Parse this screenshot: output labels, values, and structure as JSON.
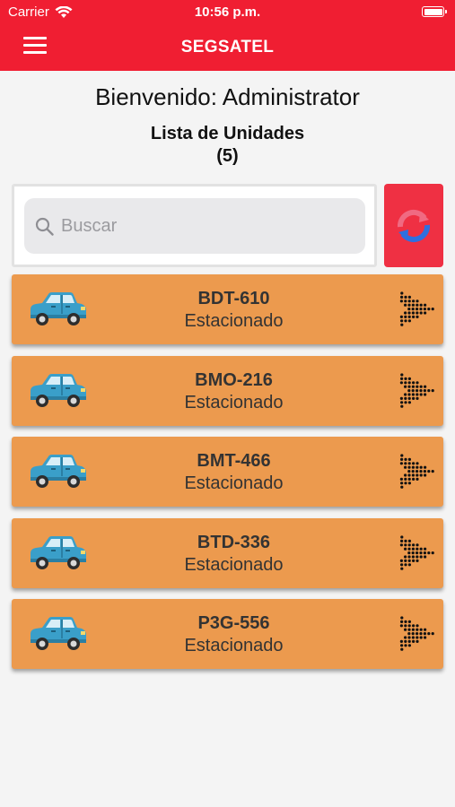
{
  "status_bar": {
    "carrier": "Carrier",
    "time": "10:56 p.m."
  },
  "header": {
    "title": "SEGSATEL",
    "menu_icon": "hamburger-menu-icon"
  },
  "welcome": "Bienvenido: Administrator",
  "list": {
    "title": "Lista de Unidades",
    "count": "(5)"
  },
  "search": {
    "placeholder": "Buscar",
    "value": "",
    "icon": "search-icon"
  },
  "refresh": {
    "icon": "refresh-icon"
  },
  "colors": {
    "header_bg": "#f01e32",
    "card_bg": "#ec9a4e",
    "refresh_bg": "#ef3043",
    "car_blue": "#3a9fc9"
  },
  "units": [
    {
      "plate": "BDT-610",
      "status": "Estacionado"
    },
    {
      "plate": "BMO-216",
      "status": "Estacionado"
    },
    {
      "plate": "BMT-466",
      "status": "Estacionado"
    },
    {
      "plate": "BTD-336",
      "status": "Estacionado"
    },
    {
      "plate": "P3G-556",
      "status": "Estacionado"
    }
  ]
}
